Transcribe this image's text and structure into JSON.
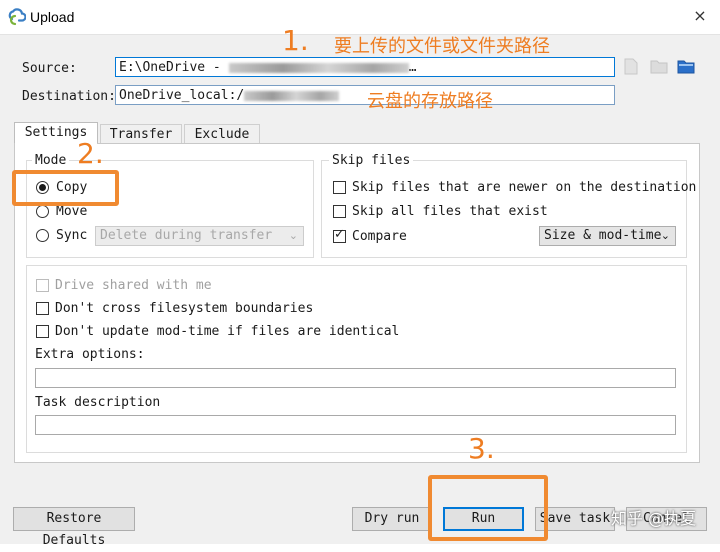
{
  "window": {
    "title": "Upload",
    "close_icon": "×"
  },
  "source": {
    "label": "Source:",
    "value_prefix": "E:\\OneDrive - ",
    "value_suffix": "…"
  },
  "destination": {
    "label": "Destination:",
    "value_prefix": "OneDrive_local:/"
  },
  "tabs": [
    {
      "label": "Settings",
      "active": true
    },
    {
      "label": "Transfer",
      "active": false
    },
    {
      "label": "Exclude",
      "active": false
    }
  ],
  "mode": {
    "title": "Mode",
    "options": [
      {
        "label": "Copy",
        "selected": true
      },
      {
        "label": "Move",
        "selected": false
      },
      {
        "label": "Sync",
        "selected": false
      }
    ],
    "sync_select": {
      "value": "Delete during transfer",
      "enabled": false
    }
  },
  "skip_files": {
    "title": "Skip files",
    "options": [
      {
        "label": "Skip files that are newer on the destination",
        "checked": false
      },
      {
        "label": "Skip all files that exist",
        "checked": false
      },
      {
        "label": "Compare",
        "checked": true
      }
    ],
    "compare_select": {
      "value": "Size & mod-time"
    }
  },
  "options": {
    "drive_shared": {
      "label": "Drive shared with me",
      "checked": false,
      "enabled": false
    },
    "no_cross_fs": {
      "label": "Don't cross filesystem boundaries",
      "checked": false
    },
    "no_update_modtime": {
      "label": "Don't update mod-time if files are identical",
      "checked": false
    },
    "extra_options": {
      "label": "Extra options:",
      "value": ""
    },
    "task_description": {
      "label": "Task description",
      "value": ""
    }
  },
  "buttons": {
    "restore_defaults": "Restore Defaults",
    "dry_run": "Dry run",
    "run": "Run",
    "save_task": "Save task",
    "cancel": "Cancel"
  },
  "annotations": {
    "step1_number": "1.",
    "step1_text": "要上传的文件或文件夹路径",
    "destination_text": "云盘的存放路径",
    "step2_number": "2.",
    "step3_number": "3."
  },
  "watermark": "知乎 @执夏",
  "colors": {
    "annotation": "#ee7d22",
    "focus_border": "#0078d7",
    "folder_icon_blue": "#2a6fc9"
  }
}
